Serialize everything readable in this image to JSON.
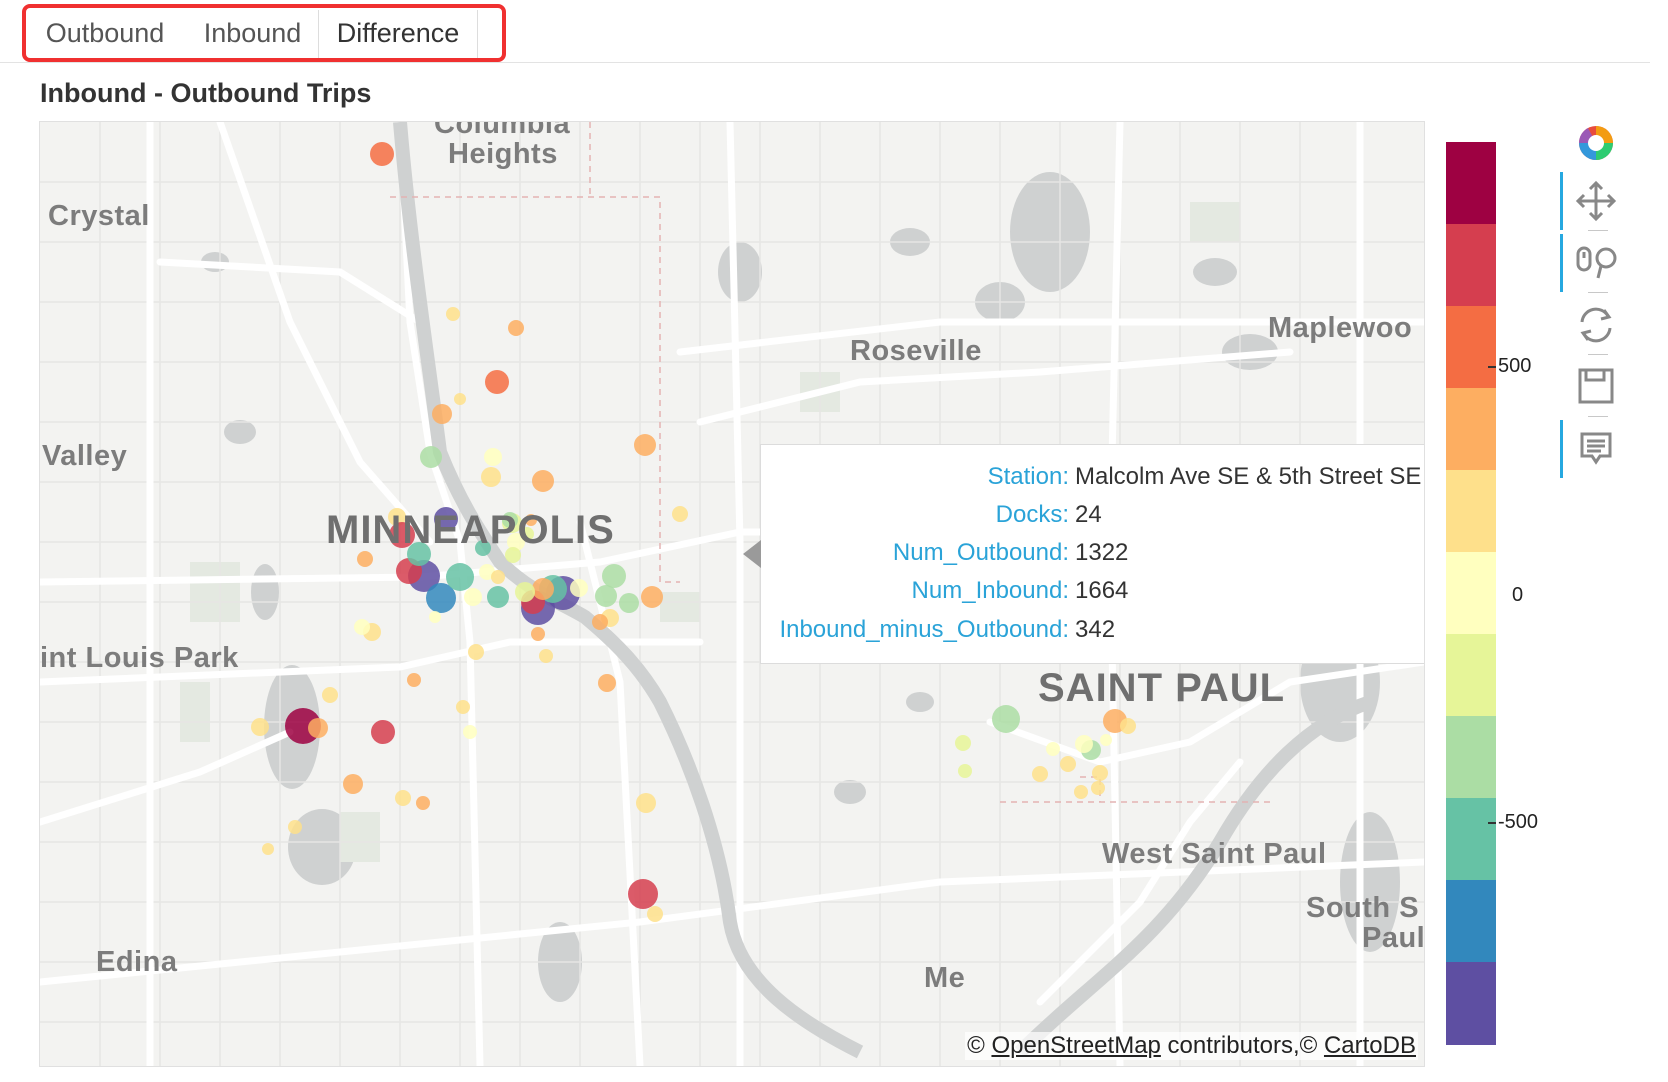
{
  "tabs": [
    {
      "label": "Outbound",
      "active": false
    },
    {
      "label": "Inbound",
      "active": false
    },
    {
      "label": "Difference",
      "active": true
    }
  ],
  "plot": {
    "title": "Inbound - Outbound Trips"
  },
  "map": {
    "places": [
      {
        "id": "columbia-heights-1",
        "text": "Columbia"
      },
      {
        "id": "columbia-heights-2",
        "text": "Heights"
      },
      {
        "id": "crystal",
        "text": "Crystal"
      },
      {
        "id": "roseville",
        "text": "Roseville"
      },
      {
        "id": "maplewood",
        "text": "Maplewoo"
      },
      {
        "id": "valley",
        "text": "Valley"
      },
      {
        "id": "minneapolis",
        "text": "MINNEAPOLIS"
      },
      {
        "id": "st-louis-park",
        "text": "int Louis Park"
      },
      {
        "id": "saint-paul",
        "text": "SAINT PAUL"
      },
      {
        "id": "west-saint-paul",
        "text": "West Saint Paul"
      },
      {
        "id": "south-st-paul-1",
        "text": "South S"
      },
      {
        "id": "south-st-paul-2",
        "text": "Paul"
      },
      {
        "id": "edina",
        "text": "Edina"
      },
      {
        "id": "mendota",
        "text": "Me"
      }
    ],
    "attribution": {
      "prefix": "© ",
      "osm_link": "OpenStreetMap",
      "middle": " contributors,© ",
      "carto_link": "CartoDB"
    }
  },
  "tooltip": {
    "rows": [
      {
        "key": "Station:",
        "value": "Malcolm Ave SE & 5th Street SE"
      },
      {
        "key": "Docks:",
        "value": "24"
      },
      {
        "key": "Num_Outbound:",
        "value": "1322"
      },
      {
        "key": "Num_Inbound:",
        "value": "1664"
      },
      {
        "key": "Inbound_minus_Outbound:",
        "value": "342"
      }
    ]
  },
  "colorbar": {
    "colors": [
      "#9e0142",
      "#d53e4f",
      "#f46d43",
      "#fdae61",
      "#fee08b",
      "#ffffbf",
      "#e6f598",
      "#abdda4",
      "#66c2a5",
      "#3288bd",
      "#5e4fa2"
    ],
    "ticks": [
      {
        "label": "500"
      },
      {
        "label": "0"
      },
      {
        "label": "-500"
      }
    ]
  },
  "toolbar": {
    "tools": [
      {
        "name": "bokeh-logo-icon",
        "active": false
      },
      {
        "name": "pan-tool-icon",
        "active": true
      },
      {
        "name": "wheel-zoom-tool-icon",
        "active": true
      },
      {
        "name": "reset-tool-icon",
        "active": false
      },
      {
        "name": "save-tool-icon",
        "active": false
      },
      {
        "name": "hover-tool-icon",
        "active": true
      }
    ]
  }
}
